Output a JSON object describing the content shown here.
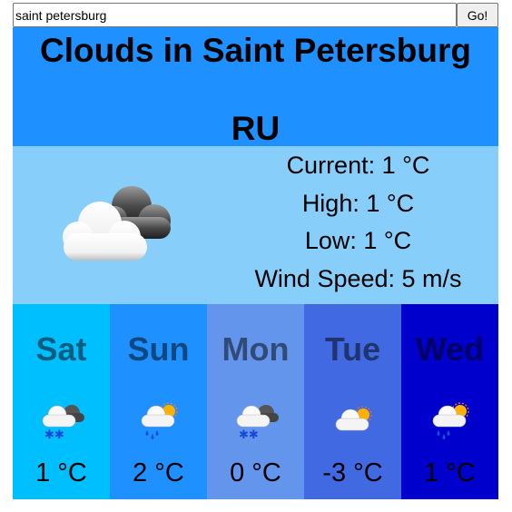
{
  "search": {
    "value": "saint petersburg",
    "button_label": "Go!"
  },
  "header": {
    "title": "Clouds in Saint Petersburg",
    "country": "RU"
  },
  "current": {
    "icon": "broken-clouds-icon",
    "current": "Current: 1 °C",
    "high": "High: 1 °C",
    "low": "Low: 1 °C",
    "wind": "Wind Speed: 5 m/s"
  },
  "forecast": [
    {
      "day": "Sat",
      "temp": "1 °C",
      "icon": "snow-icon",
      "bg": "#00bfff",
      "name_color": "#005f80"
    },
    {
      "day": "Sun",
      "temp": "2 °C",
      "icon": "rain-sun-icon",
      "bg": "#1e90ff",
      "name_color": "#0f4880"
    },
    {
      "day": "Mon",
      "temp": "0 °C",
      "icon": "snow-icon",
      "bg": "#6495ed",
      "name_color": "#324a76"
    },
    {
      "day": "Tue",
      "temp": "-3 °C",
      "icon": "partly-cloudy-icon",
      "bg": "#4169e1",
      "name_color": "#203470"
    },
    {
      "day": "Wed",
      "temp": "1 °C",
      "icon": "rain-sun-icon",
      "bg": "#0000cd",
      "name_color": "#000066"
    }
  ]
}
